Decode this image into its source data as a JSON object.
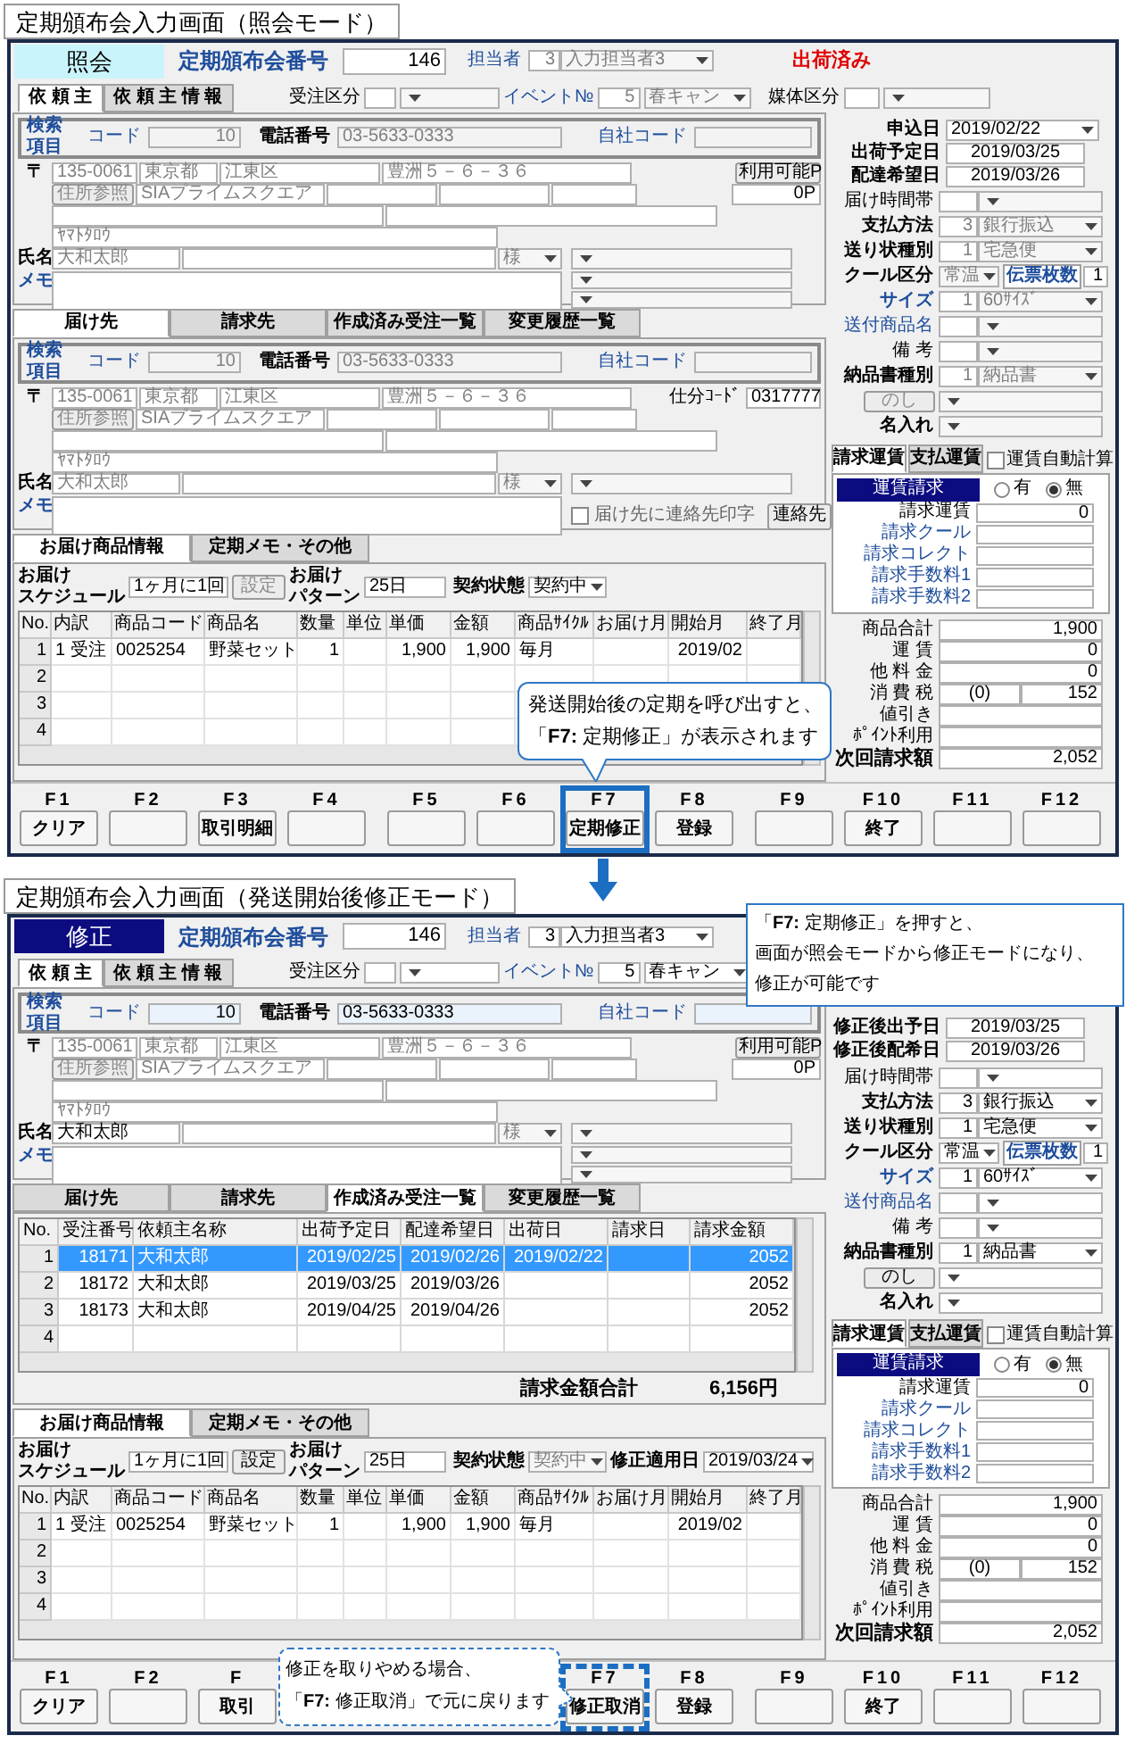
{
  "screens": [
    {
      "caption": "定期頒布会入力画面（照会モード）",
      "editable": false,
      "mode": {
        "label": "照会",
        "kind": "inquiry"
      },
      "header": {
        "number_label": "定期頒布会番号",
        "number": "146",
        "staff_label": "担当者",
        "staff_code": "3",
        "staff_name": "入力担当者3",
        "status": "出荷済み",
        "order_type_label": "受注区分",
        "event_label": "イベント№",
        "event_no": "5",
        "event_name": "春キャン",
        "media_label": "媒体区分"
      },
      "client_tabs": [
        {
          "label": "依 頼 主",
          "selected": true
        },
        {
          "label": "依 頼 主 情 報",
          "selected": false
        }
      ],
      "client": {
        "search": {
          "title": "検索項目",
          "code_label": "コード",
          "code": "10",
          "phone_label": "電話番号",
          "phone": "03-5633-0333",
          "own_code_label": "自社コード"
        },
        "zip_mark": "〒",
        "zip": "135-0061",
        "pref": "東京都",
        "city": "江東区",
        "street": "豊洲５－６－３６",
        "points_button": "利用可能P",
        "points": "0P",
        "lookup_button": "住所参照",
        "building": "SIAプライムスクエア",
        "kana": "ﾔﾏﾄﾀﾛｳ",
        "name_label": "氏名",
        "name": "大和太郎",
        "honorific": "様",
        "memo_label": "メモ"
      },
      "lower_tabs": [
        {
          "label": "届け先",
          "selected": true
        },
        {
          "label": "請求先",
          "selected": false
        },
        {
          "label": "作成済み受注一覧",
          "selected": false
        },
        {
          "label": "変更履歴一覧",
          "selected": false
        }
      ],
      "lower": {
        "kind": "delivery",
        "search": {
          "title": "検索項目",
          "code_label": "コード",
          "code": "10",
          "phone_label": "電話番号",
          "phone": "03-5633-0333",
          "own_code_label": "自社コード"
        },
        "zip_mark": "〒",
        "zip": "135-0061",
        "pref": "東京都",
        "city": "江東区",
        "street": "豊洲５－６－３６",
        "sort_code_label": "仕分ｺｰﾄﾞ",
        "sort_code": "0317777",
        "lookup_button": "住所参照",
        "building": "SIAプライムスクエア",
        "kana": "ﾔﾏﾄﾀﾛｳ",
        "name_label": "氏名",
        "name": "大和太郎",
        "honorific": "様",
        "memo_label": "メモ",
        "print_contact": {
          "label": "届け先に連絡先印字",
          "checked": false
        },
        "contact_button": "連絡先"
      },
      "product_tabs": [
        {
          "label": "お届け商品情報",
          "selected": true
        },
        {
          "label": "定期メモ・その他",
          "selected": false
        }
      ],
      "schedule": {
        "schedule_label": [
          "お届け",
          "スケジュール"
        ],
        "schedule": "1ヶ月に1回",
        "set_button": "設定",
        "pattern_label": [
          "お届け",
          "パターン"
        ],
        "pattern": "25日",
        "contract_label": "契約状態",
        "contract": "契約中"
      },
      "items": {
        "columns": [
          "No.",
          "内訳",
          "商品コード",
          "商品名",
          "数量",
          "単位",
          "単価",
          "金額",
          "商品ｻｲｸﾙ",
          "お届け月",
          "開始月",
          "終了月"
        ],
        "rows": [
          {
            "no": "1",
            "cells": [
              "1 受注",
              "0025254",
              "野菜セット",
              "1",
              null,
              "1,900",
              "1,900",
              "毎月",
              null,
              "2019/02",
              null
            ]
          },
          {
            "no": "2"
          },
          {
            "no": "3"
          },
          {
            "no": "4"
          }
        ]
      },
      "right": {
        "dates": [
          {
            "label": "申込日",
            "value": "2019/02/22",
            "dropdown": true
          },
          {
            "label": "出荷予定日",
            "value": "2019/03/25",
            "dropdown": false
          },
          {
            "label": "配達希望日",
            "value": "2019/03/26",
            "dropdown": false
          }
        ],
        "options": [
          {
            "kind": "select",
            "label": "届け時間帯"
          },
          {
            "kind": "select",
            "label": "支払方法",
            "code": "3",
            "value": "銀行振込"
          },
          {
            "kind": "select",
            "label": "送り状種別",
            "code": "1",
            "value": "宅急便"
          },
          {
            "kind": "cool",
            "label": "クール区分",
            "value": "常温",
            "slip_label": "伝票枚数",
            "slip": "1"
          },
          {
            "kind": "select",
            "label": "サイズ",
            "code": "1",
            "value": "60ｻｲｽﾞ"
          },
          {
            "kind": "select",
            "label": "送付商品名"
          },
          {
            "kind": "select",
            "label": "備 考"
          },
          {
            "kind": "select",
            "label": "納品書種別",
            "code": "1",
            "value": "納品書"
          },
          {
            "kind": "noshi",
            "label": "のし"
          },
          {
            "kind": "text",
            "label": "名入れ"
          }
        ],
        "freight": {
          "tabs": [
            {
              "label": "請求運賃",
              "selected": true
            },
            {
              "label": "支払運賃",
              "selected": false
            }
          ],
          "auto": {
            "label": "運賃自動計算",
            "checked": false
          },
          "header": "運賃請求",
          "radios": [
            {
              "label": "有",
              "selected": false
            },
            {
              "label": "無",
              "selected": true
            }
          ],
          "rows": [
            {
              "label": "請求運賃",
              "value": "0",
              "link": false
            },
            {
              "label": "請求クール",
              "link": true
            },
            {
              "label": "請求コレクト",
              "link": true
            },
            {
              "label": "請求手数料1",
              "link": true
            },
            {
              "label": "請求手数料2",
              "link": true
            }
          ]
        },
        "totals": [
          {
            "kind": "line",
            "label": "商品合計",
            "value": "1,900"
          },
          {
            "kind": "line",
            "label": "運 賃",
            "value": "0"
          },
          {
            "kind": "line",
            "label": "他 料 金",
            "value": "0"
          },
          {
            "kind": "line",
            "label": "消 費 税",
            "note": "(0)",
            "value": "152"
          },
          {
            "kind": "line",
            "label": "値引き"
          },
          {
            "kind": "line",
            "label": "ﾎﾟｲﾝﾄ利用"
          },
          {
            "kind": "grand",
            "label": "次回請求額",
            "value": "2,052"
          }
        ]
      },
      "fkey_groups": [
        [
          {
            "key": "F1",
            "label": "クリア",
            "highlighted": false
          },
          {
            "key": "F2",
            "highlighted": false
          },
          {
            "key": "F3",
            "label": "取引明細",
            "highlighted": false
          },
          {
            "key": "F4",
            "highlighted": false
          }
        ],
        [
          {
            "key": "F5",
            "highlighted": false
          },
          {
            "key": "F6",
            "highlighted": false
          },
          {
            "key": "F7",
            "label": "定期修正",
            "highlighted": true
          },
          {
            "key": "F8",
            "label": "登録",
            "highlighted": false
          }
        ],
        [
          {
            "key": "F9",
            "highlighted": false
          },
          {
            "key": "F10",
            "label": "終了",
            "highlighted": false
          },
          {
            "key": "F11",
            "highlighted": false
          },
          {
            "key": "F12",
            "highlighted": false
          }
        ]
      ],
      "callouts": [
        {
          "kind": "tail_down",
          "lines": [
            "発送開始後の定期を呼び出すと、",
            "「**F7:** 定期修正」が表示されます"
          ]
        }
      ]
    },
    {
      "caption": "定期頒布会入力画面（発送開始後修正モード）",
      "editable": true,
      "mode": {
        "label": "修正",
        "kind": "edit"
      },
      "header": {
        "number_label": "定期頒布会番号",
        "number": "146",
        "staff_label": "担当者",
        "staff_code": "3",
        "staff_name": "入力担当者3",
        "order_type_label": "受注区分",
        "event_label": "イベント№",
        "event_no": "5",
        "event_name": "春キャン"
      },
      "client_tabs": [
        {
          "label": "依 頼 主",
          "selected": true
        },
        {
          "label": "依 頼 主 情 報",
          "selected": false
        }
      ],
      "client": {
        "search": {
          "title": "検索項目",
          "code_label": "コード",
          "code": "10",
          "phone_label": "電話番号",
          "phone": "03-5633-0333",
          "own_code_label": "自社コード"
        },
        "zip_mark": "〒",
        "zip": "135-0061",
        "pref": "東京都",
        "city": "江東区",
        "street": "豊洲５－６－３６",
        "points_button": "利用可能P",
        "points": "0P",
        "lookup_button": "住所参照",
        "building": "SIAプライムスクエア",
        "kana": "ﾔﾏﾄﾀﾛｳ",
        "name_label": "氏名",
        "name": "大和太郎",
        "honorific": "様",
        "memo_label": "メモ"
      },
      "lower_tabs": [
        {
          "label": "届け先",
          "selected": false
        },
        {
          "label": "請求先",
          "selected": false
        },
        {
          "label": "作成済み受注一覧",
          "selected": true
        },
        {
          "label": "変更履歴一覧",
          "selected": false
        }
      ],
      "lower": {
        "kind": "orders",
        "columns": [
          "No.",
          "受注番号",
          "依頼主名称",
          "出荷予定日",
          "配達希望日",
          "出荷日",
          "請求日",
          "請求金額"
        ],
        "rows": [
          {
            "no": "1",
            "selected": true,
            "cells": [
              "18171",
              "大和太郎",
              "2019/02/25",
              "2019/02/26",
              "2019/02/22",
              null,
              "2052"
            ]
          },
          {
            "no": "2",
            "selected": false,
            "cells": [
              "18172",
              "大和太郎",
              "2019/03/25",
              "2019/03/26",
              null,
              null,
              "2052"
            ]
          },
          {
            "no": "3",
            "selected": false,
            "cells": [
              "18173",
              "大和太郎",
              "2019/04/25",
              "2019/04/26",
              null,
              null,
              "2052"
            ]
          },
          {
            "no": "4",
            "selected": false
          }
        ],
        "total_label": "請求金額合計",
        "total": "6,156円"
      },
      "product_tabs": [
        {
          "label": "お届け商品情報",
          "selected": true
        },
        {
          "label": "定期メモ・その他",
          "selected": false
        }
      ],
      "schedule": {
        "schedule_label": [
          "お届け",
          "スケジュール"
        ],
        "schedule": "1ヶ月に1回",
        "set_button": "設定",
        "pattern_label": [
          "お届け",
          "パターン"
        ],
        "pattern": "25日",
        "contract_label": "契約状態",
        "contract": "契約中",
        "apply_label": "修正適用日",
        "apply_date": "2019/03/24"
      },
      "items": {
        "columns": [
          "No.",
          "内訳",
          "商品コード",
          "商品名",
          "数量",
          "単位",
          "単価",
          "金額",
          "商品ｻｲｸﾙ",
          "お届け月",
          "開始月",
          "終了月"
        ],
        "rows": [
          {
            "no": "1",
            "cells": [
              "1 受注",
              "0025254",
              "野菜セット",
              "1",
              null,
              "1,900",
              "1,900",
              "毎月",
              null,
              "2019/02",
              null
            ]
          },
          {
            "no": "2"
          },
          {
            "no": "3"
          },
          {
            "no": "4"
          }
        ]
      },
      "right": {
        "dates": [
          {
            "label": "修正後出予日",
            "value": "2019/03/25",
            "dropdown": false
          },
          {
            "label": "修正後配希日",
            "value": "2019/03/26",
            "dropdown": false
          }
        ],
        "options": [
          {
            "kind": "select",
            "label": "届け時間帯"
          },
          {
            "kind": "select",
            "label": "支払方法",
            "code": "3",
            "value": "銀行振込"
          },
          {
            "kind": "select",
            "label": "送り状種別",
            "code": "1",
            "value": "宅急便"
          },
          {
            "kind": "cool",
            "label": "クール区分",
            "value": "常温",
            "slip_label": "伝票枚数",
            "slip": "1"
          },
          {
            "kind": "select",
            "label": "サイズ",
            "code": "1",
            "value": "60ｻｲｽﾞ"
          },
          {
            "kind": "select",
            "label": "送付商品名"
          },
          {
            "kind": "select",
            "label": "備 考"
          },
          {
            "kind": "select",
            "label": "納品書種別",
            "code": "1",
            "value": "納品書"
          },
          {
            "kind": "noshi",
            "label": "のし"
          },
          {
            "kind": "text",
            "label": "名入れ"
          }
        ],
        "freight": {
          "tabs": [
            {
              "label": "請求運賃",
              "selected": true
            },
            {
              "label": "支払運賃",
              "selected": false
            }
          ],
          "auto": {
            "label": "運賃自動計算",
            "checked": false
          },
          "header": "運賃請求",
          "radios": [
            {
              "label": "有",
              "selected": false
            },
            {
              "label": "無",
              "selected": true
            }
          ],
          "rows": [
            {
              "label": "請求運賃",
              "value": "0",
              "link": false
            },
            {
              "label": "請求クール",
              "link": true
            },
            {
              "label": "請求コレクト",
              "link": true
            },
            {
              "label": "請求手数料1",
              "link": true
            },
            {
              "label": "請求手数料2",
              "link": true
            }
          ]
        },
        "totals": [
          {
            "kind": "line",
            "label": "商品合計",
            "value": "1,900"
          },
          {
            "kind": "line",
            "label": "運 賃",
            "value": "0"
          },
          {
            "kind": "line",
            "label": "他 料 金",
            "value": "0"
          },
          {
            "kind": "line",
            "label": "消 費 税",
            "note": "(0)",
            "value": "152"
          },
          {
            "kind": "line",
            "label": "値引き"
          },
          {
            "kind": "line",
            "label": "ﾎﾟｲﾝﾄ利用"
          },
          {
            "kind": "grand",
            "label": "次回請求額",
            "value": "2,052"
          }
        ]
      },
      "fkey_groups": [
        [
          {
            "key": "F1",
            "label": "クリア",
            "highlighted": false
          },
          {
            "key": "F2",
            "highlighted": false
          },
          {
            "key": "F",
            "label": "取引",
            "highlighted": false
          }
        ],
        [
          {
            "key": "F7",
            "label": "修正取消",
            "highlighted": true
          },
          {
            "key": "F8",
            "label": "登録",
            "highlighted": false
          }
        ],
        [
          {
            "key": "F9",
            "highlighted": false
          },
          {
            "key": "F10",
            "label": "終了",
            "highlighted": false
          },
          {
            "key": "F11",
            "highlighted": false
          },
          {
            "key": "F12",
            "highlighted": false
          }
        ]
      ],
      "callouts": [
        {
          "kind": "box",
          "lines": [
            "「**F7:** 定期修正」を押すと、",
            "画面が照会モードから修正モードになり、",
            "修正が可能です"
          ]
        },
        {
          "kind": "dashed",
          "lines": [
            "修正を取りやめる場合、",
            "「**F7:** 修正取消」で元に戻ります"
          ]
        }
      ]
    }
  ]
}
